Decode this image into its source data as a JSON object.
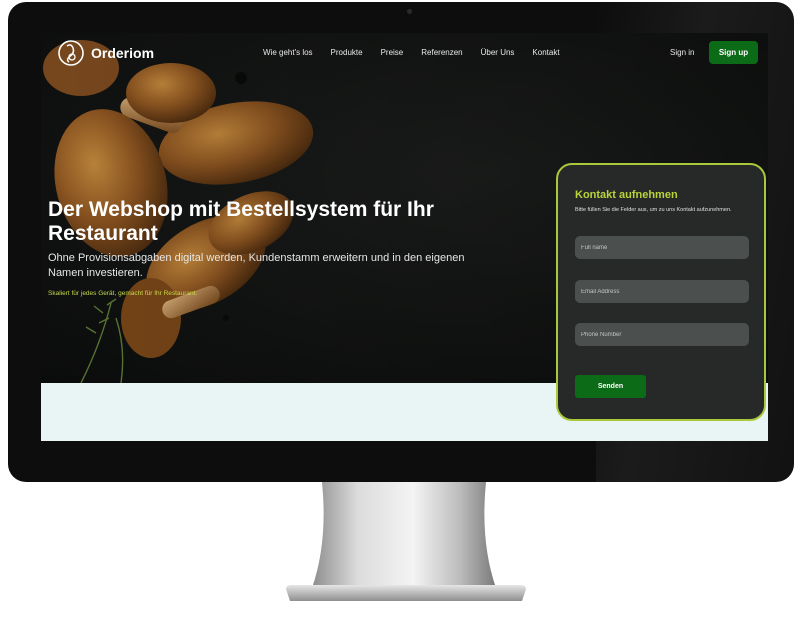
{
  "brand": {
    "name": "Orderiom"
  },
  "nav": {
    "links": [
      "Wie geht's los",
      "Produkte",
      "Preise",
      "Referenzen",
      "Über Uns",
      "Kontakt"
    ],
    "signin": "Sign in",
    "signup": "Sign up"
  },
  "hero": {
    "title": "Der Webshop mit Bestellsystem für Ihr Restaurant",
    "subtitle": "Ohne Provisionsabgaben digital werden, Kundenstamm erweitern und in den eigenen Namen investieren.",
    "tagline": "Skaliert für jedes Gerät, gemacht für Ihr Restaurant."
  },
  "contact": {
    "title": "Kontakt aufnehmen",
    "description": "Bitte füllen Sie die Felder aus, um zu uns Kontakt aufzunehmen.",
    "fullname_placeholder": "Full name",
    "email_placeholder": "Email Address",
    "phone_placeholder": "Phone Number",
    "submit": "Senden"
  },
  "colors": {
    "accent_green": "#0c6b16",
    "lime": "#b8d43a",
    "card_bg": "#262928",
    "hero_bg": "#121413",
    "below_fold": "#e9f4f4"
  },
  "icons": [
    "orderiom-logo-icon"
  ]
}
